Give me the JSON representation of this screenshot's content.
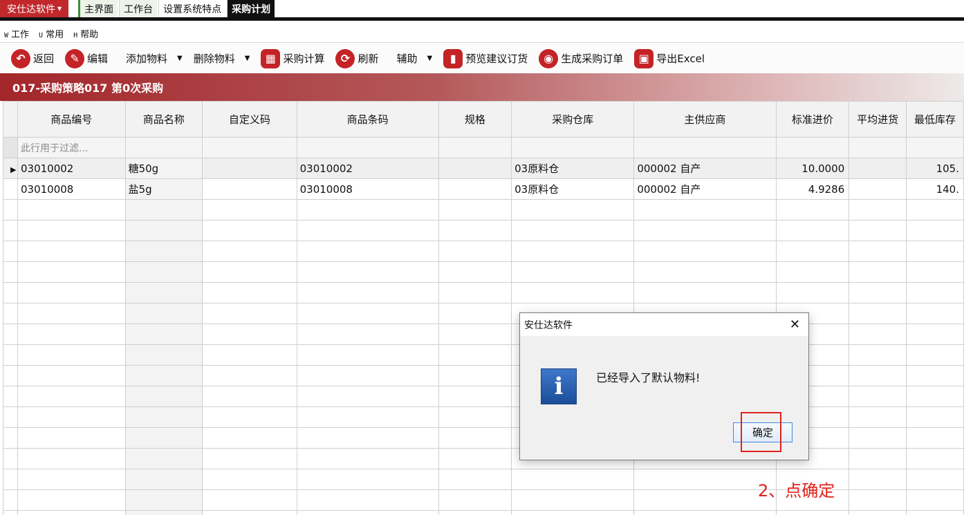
{
  "app": {
    "brand": "安仕达软件",
    "tabs": [
      "主界面",
      "工作台",
      "设置系统特点",
      "采购计划"
    ]
  },
  "menu": [
    {
      "key": "W",
      "label": "工作"
    },
    {
      "key": "U",
      "label": "常用"
    },
    {
      "key": "H",
      "label": "帮助"
    }
  ],
  "toolbar": {
    "back": "返回",
    "edit": "编辑",
    "add_material": "添加物料",
    "delete_material": "删除物料",
    "purchase_calc": "采购计算",
    "refresh": "刷新",
    "assist": "辅助",
    "preview_suggest": "预览建议订货",
    "generate_po": "生成采购订单",
    "export_excel": "导出Excel"
  },
  "banner": "017-采购策略017  第0次采购",
  "grid": {
    "columns": [
      "商品编号",
      "商品名称",
      "自定义码",
      "商品条码",
      "规格",
      "采购仓库",
      "主供应商",
      "标准进价",
      "平均进货",
      "最低库存"
    ],
    "filter_placeholder": "此行用于过滤...",
    "rows": [
      {
        "code": "03010002",
        "name": "糖50g",
        "custom": "",
        "barcode": "03010002",
        "spec": "",
        "warehouse": "03原料仓",
        "supplier": "000002 自产",
        "std_price": "10.0000",
        "avg_price": "",
        "min_stock": "105."
      },
      {
        "code": "03010008",
        "name": "盐5g",
        "custom": "",
        "barcode": "03010008",
        "spec": "",
        "warehouse": "03原料仓",
        "supplier": "000002 自产",
        "std_price": "4.9286",
        "avg_price": "",
        "min_stock": "140."
      }
    ]
  },
  "dialog": {
    "title": "安仕达软件",
    "message": "已经导入了默认物料!",
    "ok": "确定"
  },
  "annotation": "2、点确定",
  "colors": {
    "accent": "#c42327",
    "annotation": "#e0221c"
  }
}
